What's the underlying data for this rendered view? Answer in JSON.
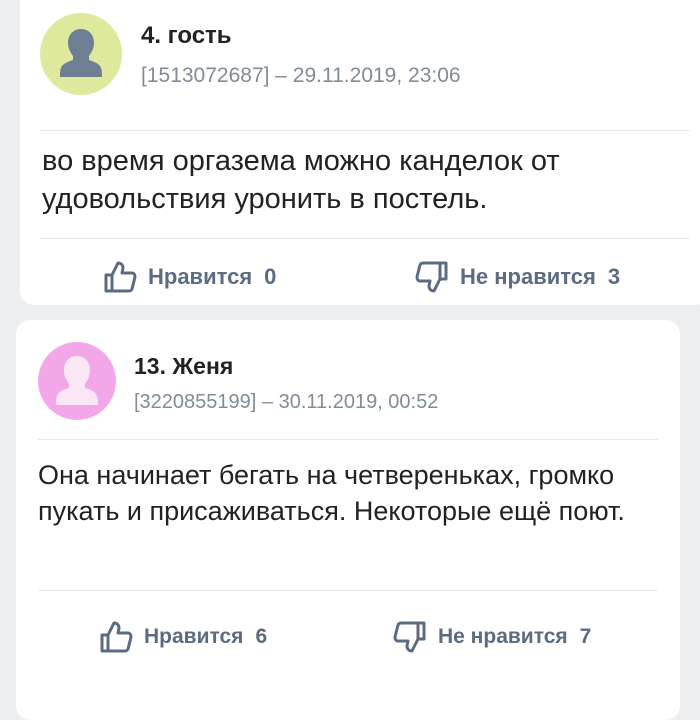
{
  "comments": [
    {
      "author": "4. гость",
      "meta": "[1513072687] – 29.11.2019, 23:06",
      "text": "во время оргазема можно канделок от удовольствия уронить в постель.",
      "avatar": {
        "icon": "user-silhouette-icon",
        "bg": "#dfe99e",
        "fg": "#6e7f93"
      },
      "like_label": "Нравится",
      "like_count": "0",
      "dislike_label": "Не нравится",
      "dislike_count": "3"
    },
    {
      "author": "13. Женя",
      "meta": "[3220855199] – 30.11.2019, 00:52",
      "text": "Она начинает бегать на четвереньках, громко пукать и присаживаться. Некоторые ещё поют.",
      "avatar": {
        "icon": "user-silhouette-icon",
        "bg": "#f2a8e8",
        "fg": "#fbe6f6"
      },
      "like_label": "Нравится",
      "like_count": "6",
      "dislike_label": "Не нравится",
      "dislike_count": "7"
    }
  ],
  "colors": {
    "background": "#edeef0",
    "card": "#ffffff",
    "accent": "#5b6b81",
    "meta": "#818c99"
  }
}
